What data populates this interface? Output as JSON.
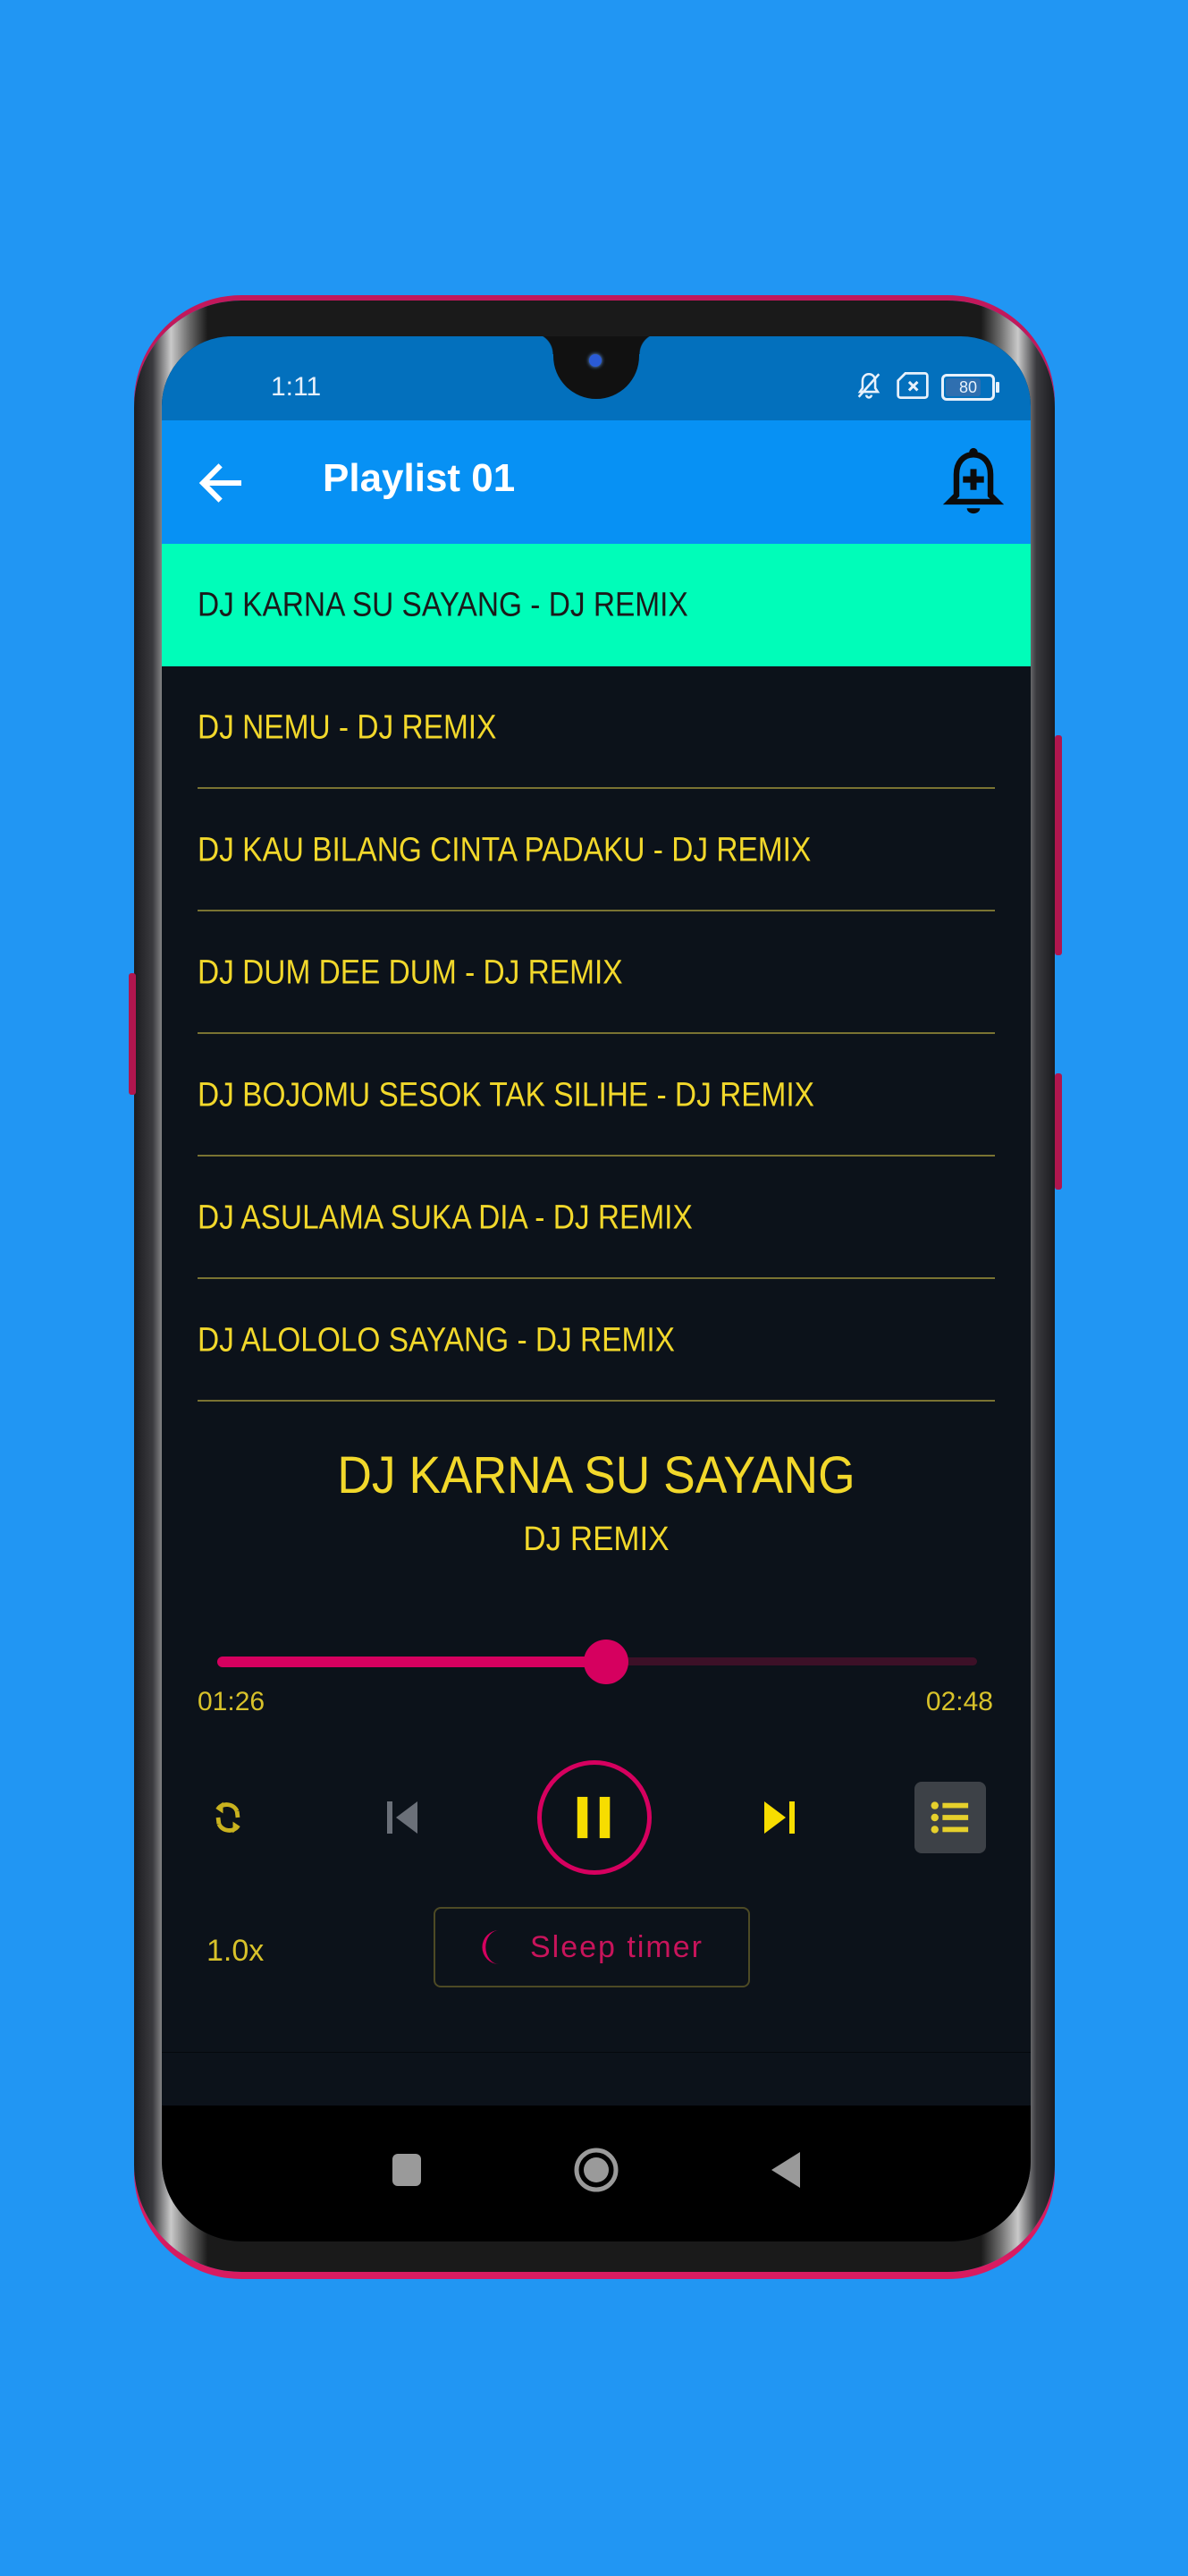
{
  "status_bar": {
    "time": "1:11",
    "battery_level": "80",
    "icons": [
      "bell-off-icon",
      "no-sim-icon",
      "battery-icon"
    ]
  },
  "app_bar": {
    "title": "Playlist 01",
    "back_icon": "arrow-left-icon",
    "action_icon": "bell-plus-icon"
  },
  "playlist": {
    "active_index": 0,
    "tracks": [
      {
        "label": "DJ KARNA SU SAYANG - DJ REMIX"
      },
      {
        "label": "DJ NEMU - DJ REMIX"
      },
      {
        "label": "DJ KAU BILANG CINTA PADAKU - DJ REMIX"
      },
      {
        "label": "DJ DUM DEE DUM - DJ REMIX"
      },
      {
        "label": "DJ BOJOMU SESOK TAK SILIHE - DJ REMIX"
      },
      {
        "label": "DJ ASULAMA SUKA DIA - DJ REMIX"
      },
      {
        "label": "DJ ALOLOLO SAYANG - DJ REMIX"
      }
    ]
  },
  "now_playing": {
    "title": "DJ KARNA SU SAYANG",
    "artist": "DJ REMIX",
    "current_time": "01:26",
    "total_time": "02:48",
    "progress_fraction": 0.512
  },
  "controls": {
    "repeat_icon": "repeat-icon",
    "prev_icon": "skip-previous-icon",
    "play_state_icon": "pause-icon",
    "next_icon": "skip-next-icon",
    "list_icon": "list-icon"
  },
  "bottom": {
    "speed": "1.0x",
    "sleep_timer_label": "Sleep timer"
  },
  "nav": {
    "items": [
      "recents-icon",
      "home-icon",
      "back-icon"
    ]
  },
  "colors": {
    "background": "#2196F3",
    "app_bar": "#0791F4",
    "status_bar": "#0370BD",
    "active_row": "#00FDB9",
    "text_accent": "#F2D82B",
    "seek_accent": "#D6005F",
    "screen_bg": "#0C121A"
  }
}
